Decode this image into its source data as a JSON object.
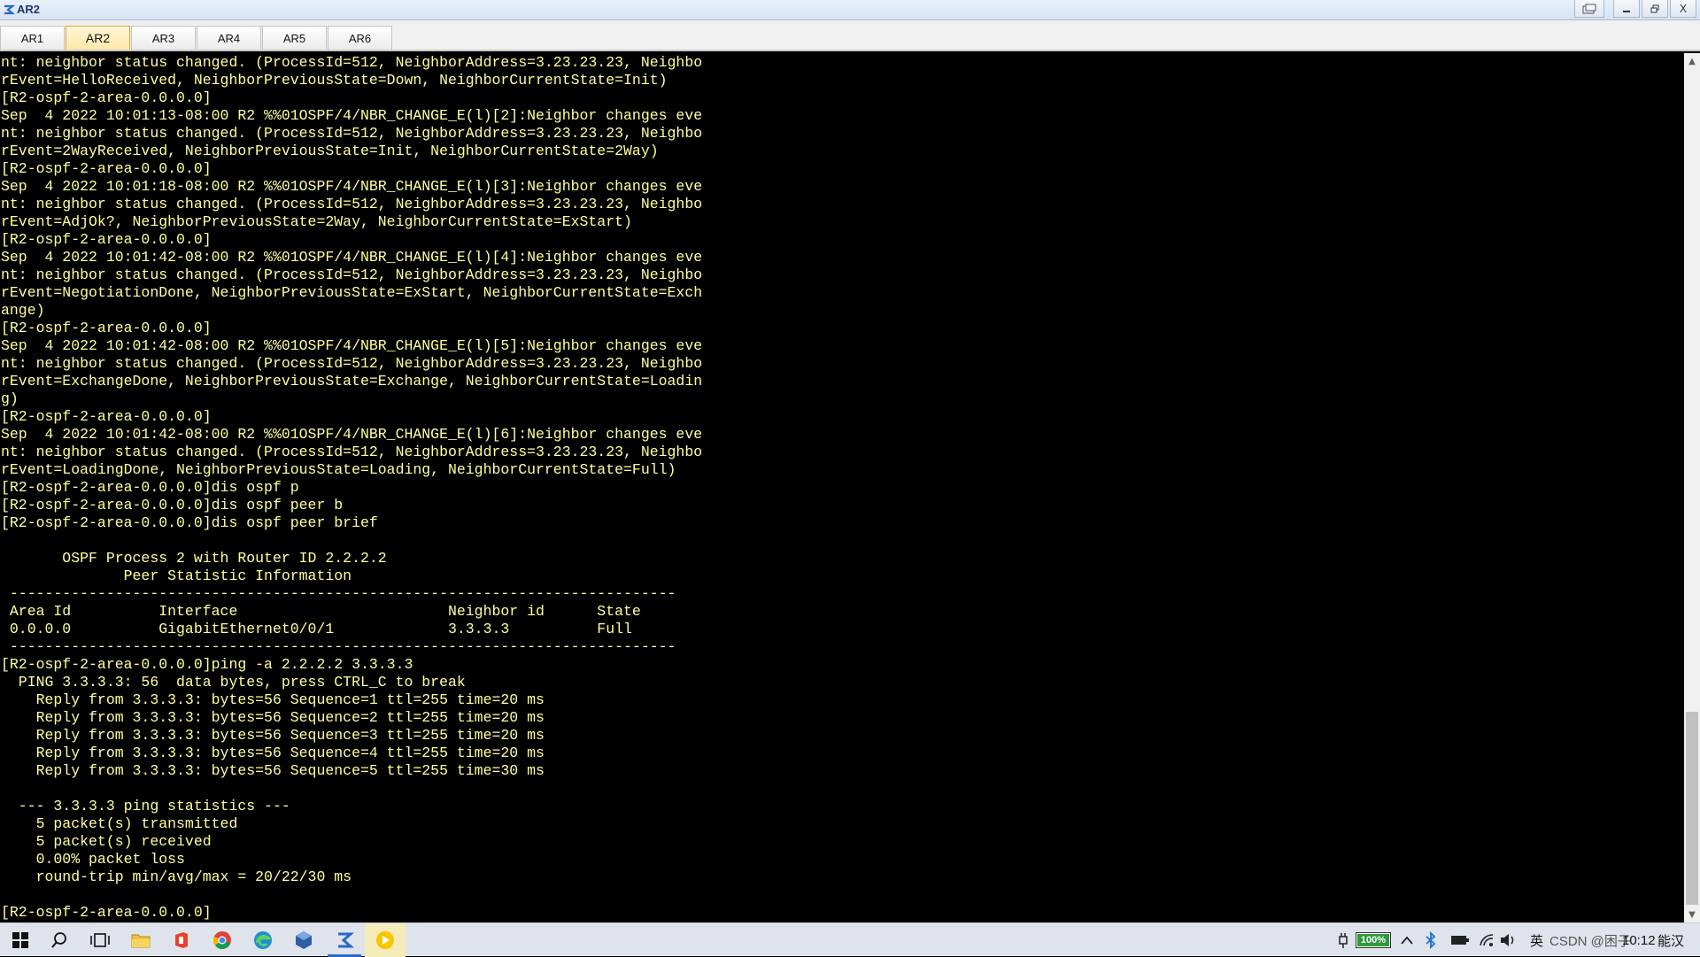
{
  "window": {
    "title": "AR2",
    "controls": [
      "restore-icon",
      "minimize",
      "maximize",
      "close"
    ],
    "close_label": "X"
  },
  "tabs": [
    {
      "label": "AR1",
      "active": false
    },
    {
      "label": "AR2",
      "active": true
    },
    {
      "label": "AR3",
      "active": false
    },
    {
      "label": "AR4",
      "active": false
    },
    {
      "label": "AR5",
      "active": false
    },
    {
      "label": "AR6",
      "active": false
    }
  ],
  "terminal": {
    "text_color": "#ffff9e",
    "background": "#000000",
    "lines": [
      "nt: neighbor status changed. (ProcessId=512, NeighborAddress=3.23.23.23, Neighbo",
      "rEvent=HelloReceived, NeighborPreviousState=Down, NeighborCurrentState=Init)",
      "[R2-ospf-2-area-0.0.0.0]",
      "Sep  4 2022 10:01:13-08:00 R2 %%01OSPF/4/NBR_CHANGE_E(l)[2]:Neighbor changes eve",
      "nt: neighbor status changed. (ProcessId=512, NeighborAddress=3.23.23.23, Neighbo",
      "rEvent=2WayReceived, NeighborPreviousState=Init, NeighborCurrentState=2Way)",
      "[R2-ospf-2-area-0.0.0.0]",
      "Sep  4 2022 10:01:18-08:00 R2 %%01OSPF/4/NBR_CHANGE_E(l)[3]:Neighbor changes eve",
      "nt: neighbor status changed. (ProcessId=512, NeighborAddress=3.23.23.23, Neighbo",
      "rEvent=AdjOk?, NeighborPreviousState=2Way, NeighborCurrentState=ExStart)",
      "[R2-ospf-2-area-0.0.0.0]",
      "Sep  4 2022 10:01:42-08:00 R2 %%01OSPF/4/NBR_CHANGE_E(l)[4]:Neighbor changes eve",
      "nt: neighbor status changed. (ProcessId=512, NeighborAddress=3.23.23.23, Neighbo",
      "rEvent=NegotiationDone, NeighborPreviousState=ExStart, NeighborCurrentState=Exch",
      "ange)",
      "[R2-ospf-2-area-0.0.0.0]",
      "Sep  4 2022 10:01:42-08:00 R2 %%01OSPF/4/NBR_CHANGE_E(l)[5]:Neighbor changes eve",
      "nt: neighbor status changed. (ProcessId=512, NeighborAddress=3.23.23.23, Neighbo",
      "rEvent=ExchangeDone, NeighborPreviousState=Exchange, NeighborCurrentState=Loadin",
      "g)",
      "[R2-ospf-2-area-0.0.0.0]",
      "Sep  4 2022 10:01:42-08:00 R2 %%01OSPF/4/NBR_CHANGE_E(l)[6]:Neighbor changes eve",
      "nt: neighbor status changed. (ProcessId=512, NeighborAddress=3.23.23.23, Neighbo",
      "rEvent=LoadingDone, NeighborPreviousState=Loading, NeighborCurrentState=Full)",
      "[R2-ospf-2-area-0.0.0.0]dis ospf p",
      "[R2-ospf-2-area-0.0.0.0]dis ospf peer b",
      "[R2-ospf-2-area-0.0.0.0]dis ospf peer brief",
      "",
      "       OSPF Process 2 with Router ID 2.2.2.2",
      "              Peer Statistic Information",
      " ----------------------------------------------------------------------------",
      " Area Id          Interface                        Neighbor id      State",
      " 0.0.0.0          GigabitEthernet0/0/1             3.3.3.3          Full",
      " ----------------------------------------------------------------------------",
      "[R2-ospf-2-area-0.0.0.0]ping -a 2.2.2.2 3.3.3.3",
      "  PING 3.3.3.3: 56  data bytes, press CTRL_C to break",
      "    Reply from 3.3.3.3: bytes=56 Sequence=1 ttl=255 time=20 ms",
      "    Reply from 3.3.3.3: bytes=56 Sequence=2 ttl=255 time=20 ms",
      "    Reply from 3.3.3.3: bytes=56 Sequence=3 ttl=255 time=20 ms",
      "    Reply from 3.3.3.3: bytes=56 Sequence=4 ttl=255 time=20 ms",
      "    Reply from 3.3.3.3: bytes=56 Sequence=5 ttl=255 time=30 ms",
      "",
      "  --- 3.3.3.3 ping statistics ---",
      "    5 packet(s) transmitted",
      "    5 packet(s) received",
      "    0.00% packet loss",
      "    round-trip min/avg/max = 20/22/30 ms",
      "",
      "[R2-ospf-2-area-0.0.0.0]"
    ]
  },
  "scrollbar": {
    "position_fraction": 0.82
  },
  "taskbar": {
    "apps": [
      "windows-start-icon",
      "search-icon",
      "task-view-icon",
      "file-explorer-icon",
      "office-icon",
      "chrome-icon",
      "edge-icon",
      "virtualbox-icon",
      "ensp-icon",
      "media-player-icon"
    ],
    "battery_label": "100%",
    "battery_level": 1.0,
    "tray_texts": {
      "ime": "英",
      "csdn_watermark": "CSDN @困子",
      "clock": "10:12",
      "extra": "能汉"
    }
  }
}
